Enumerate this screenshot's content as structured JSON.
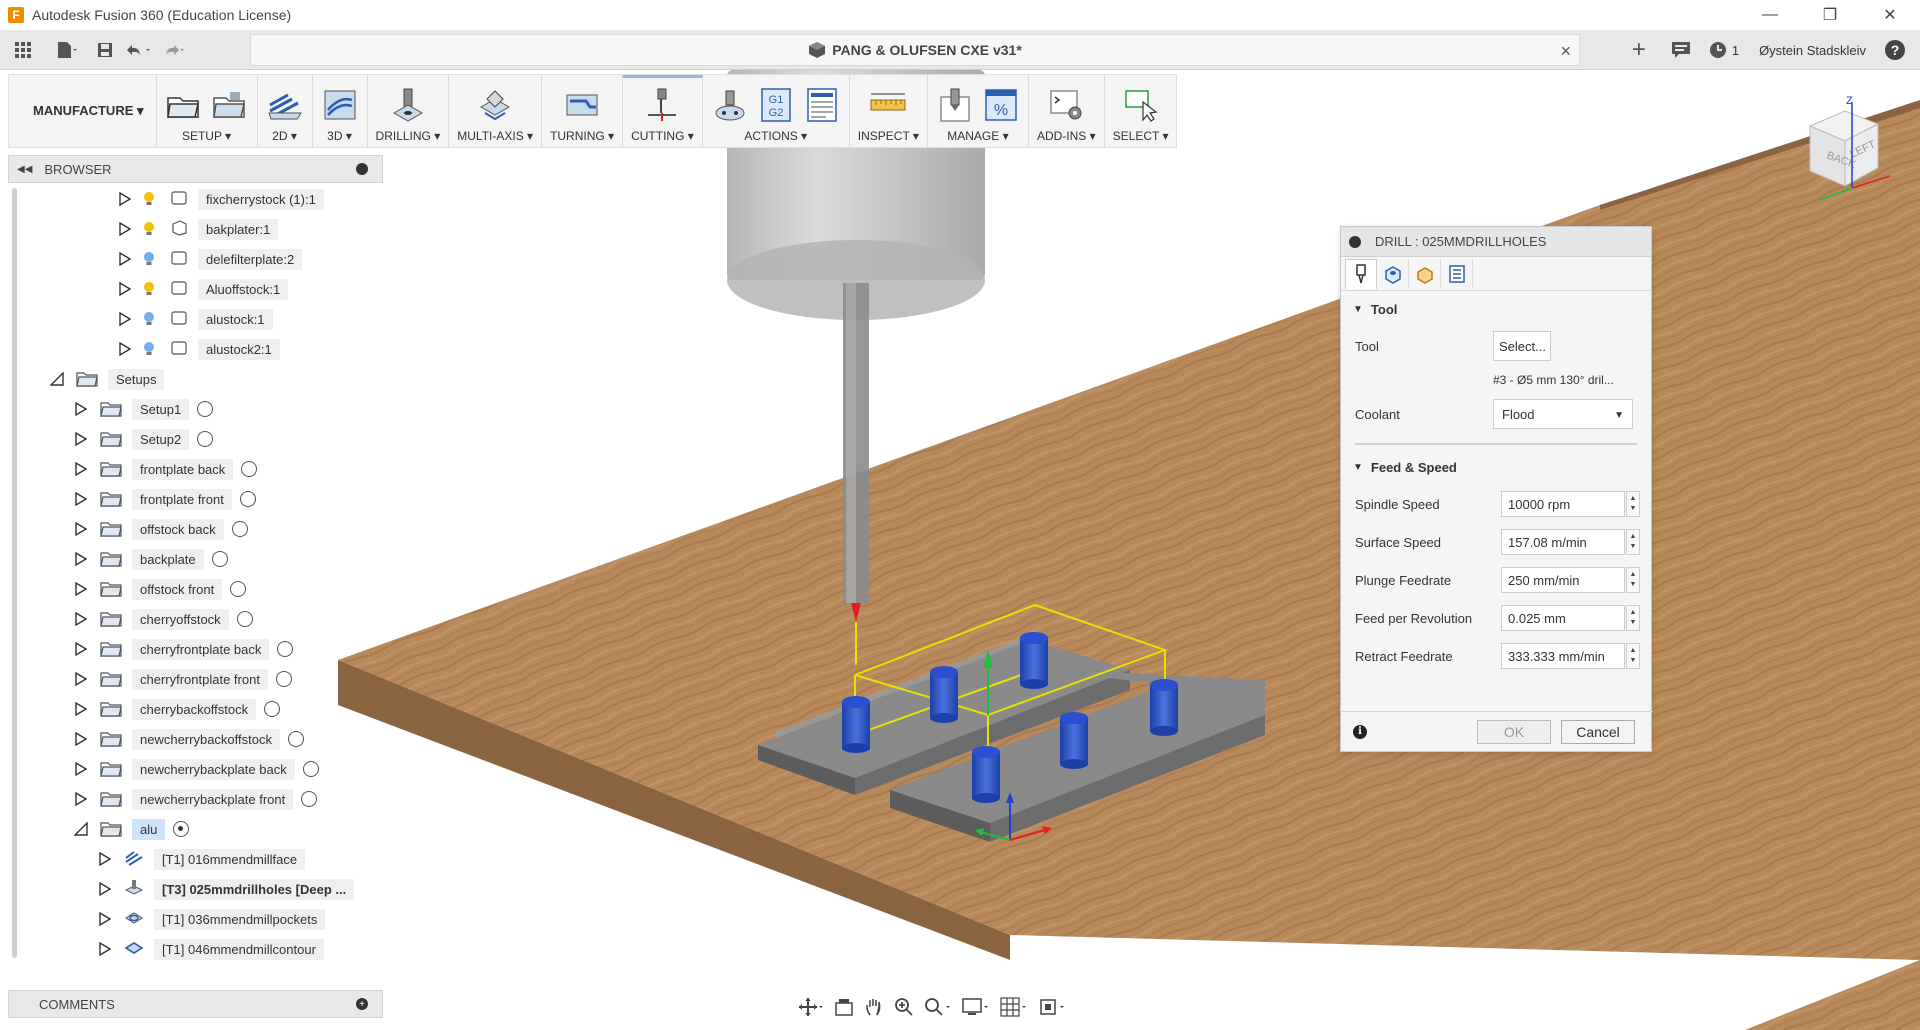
{
  "window": {
    "title": "Autodesk Fusion 360 (Education License)",
    "app_logo": "F",
    "minimize": "—",
    "restore": "❐",
    "close": "✕"
  },
  "tabbar": {
    "document_title": "PANG & OLUFSEN CXE v31*",
    "close_tab": "×",
    "new_tab": "+",
    "jobs_count": "1",
    "user_name": "Øystein Stadskleiv",
    "help": "?"
  },
  "toolbar": {
    "workspace": "MANUFACTURE ▾",
    "groups": {
      "setup": "SETUP ▾",
      "twod": "2D ▾",
      "threed": "3D ▾",
      "drilling": "DRILLING ▾",
      "multiaxis": "MULTI-AXIS ▾",
      "turning": "TURNING ▾",
      "cutting": "CUTTING ▾",
      "actions": "ACTIONS ▾",
      "inspect": "INSPECT ▾",
      "manage": "MANAGE ▾",
      "addins": "ADD-INS ▾",
      "select": "SELECT ▾"
    },
    "gcode_label": "G1 G2",
    "percent_label": "%"
  },
  "browser": {
    "title": "BROWSER",
    "bodies": [
      {
        "label": "fixcherrystock (1):1",
        "bulb": "#f2c200"
      },
      {
        "label": "bakplater:1",
        "bulb": "#f2c200"
      },
      {
        "label": "delefilterplate:2",
        "bulb": "#6fb1e8"
      },
      {
        "label": "Aluoffstock:1",
        "bulb": "#f2c200"
      },
      {
        "label": "alustock:1",
        "bulb": "#6fb1e8"
      },
      {
        "label": "alustock2:1",
        "bulb": "#6fb1e8"
      }
    ],
    "setups_label": "Setups",
    "setups": [
      "Setup1",
      "Setup2",
      "frontplate back",
      "frontplate front",
      "offstock back",
      "backplate",
      "offstock front",
      "cherryoffstock",
      "cherryfrontplate back",
      "cherryfrontplate front",
      "cherrybackoffstock",
      "newcherrybackoffstock",
      "newcherrybackplate back",
      "newcherrybackplate front"
    ],
    "active_setup": "alu",
    "operations": [
      {
        "label": "[T1] 016mmendmillface",
        "icon": "face-icon",
        "bold": false
      },
      {
        "label": "[T3] 025mmdrillholes [Deep ...",
        "icon": "drill-icon",
        "bold": true
      },
      {
        "label": "[T1] 036mmendmillpockets",
        "icon": "pocket-icon",
        "bold": false
      },
      {
        "label": "[T1] 046mmendmillcontour",
        "icon": "contour-icon",
        "bold": false
      }
    ]
  },
  "comments": {
    "title": "COMMENTS",
    "plus": "+"
  },
  "dialog": {
    "title": "DRILL : 025MMDRILLHOLES",
    "tool_section": "Tool",
    "tool_label": "Tool",
    "tool_button": "Select...",
    "tool_desc": "#3 - Ø5 mm 130° dril...",
    "coolant_label": "Coolant",
    "coolant_value": "Flood",
    "feed_section": "Feed & Speed",
    "fields": [
      {
        "label": "Spindle Speed",
        "value": "10000 rpm"
      },
      {
        "label": "Surface Speed",
        "value": "157.08 m/min"
      },
      {
        "label": "Plunge Feedrate",
        "value": "250 mm/min"
      },
      {
        "label": "Feed per Revolution",
        "value": "0.025 mm"
      },
      {
        "label": "Retract Feedrate",
        "value": "333.333 mm/min"
      }
    ],
    "ok": "OK",
    "cancel": "Cancel",
    "info": "i"
  },
  "viewcube": {
    "back": "BACK",
    "left": "LEFT",
    "z": "Z",
    "x": "X"
  },
  "colors": {
    "wood": "#b5875a",
    "wood_dark": "#8f6a43",
    "stock": "#7d7d7d",
    "hole": "#2f55c8",
    "stock_box": "#e8e000",
    "tool_tip": "#e02020",
    "axis_up": "#1fbf3a",
    "selection": "#cfe3fa"
  }
}
